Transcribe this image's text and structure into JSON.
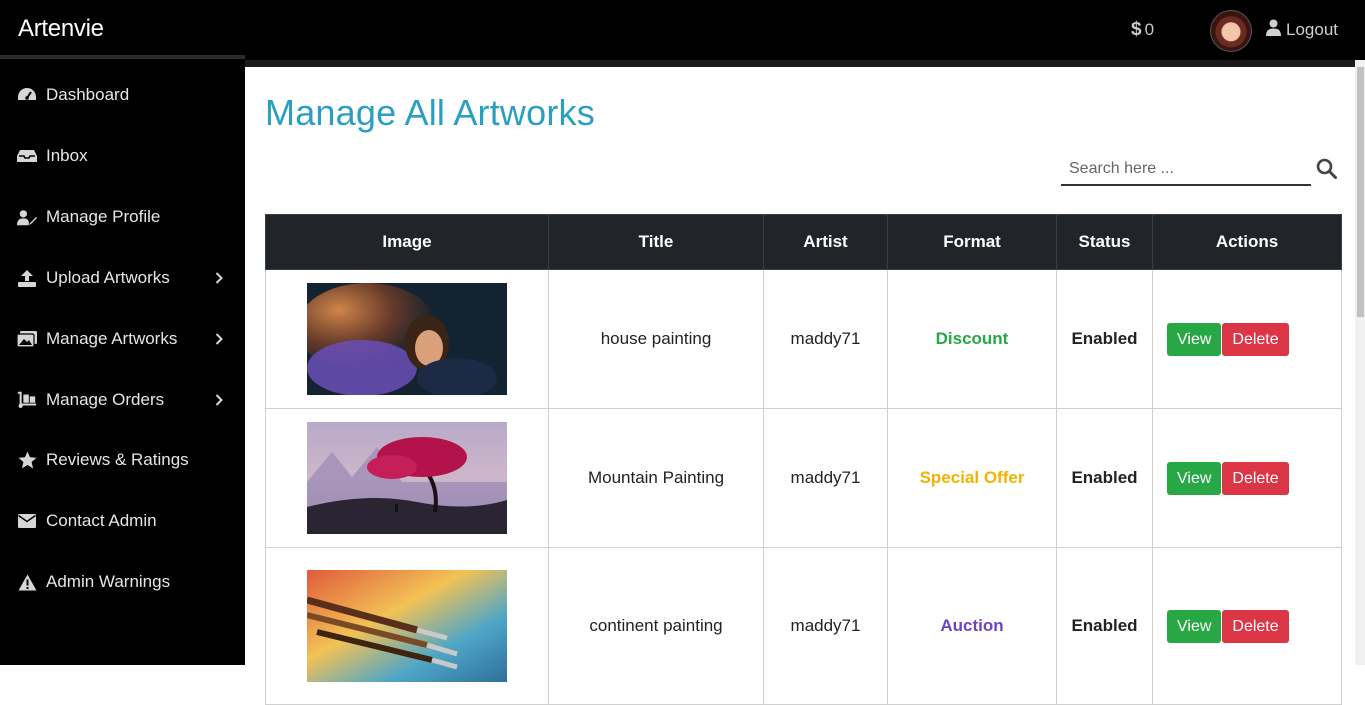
{
  "app": {
    "brand": "Artenvie"
  },
  "header": {
    "balance_symbol": "$",
    "balance_value": "0",
    "logout_label": "Logout"
  },
  "sidebar": {
    "items": [
      {
        "label": "Dashboard",
        "icon": "dashboard-icon",
        "has_submenu": false
      },
      {
        "label": "Inbox",
        "icon": "inbox-icon",
        "has_submenu": false
      },
      {
        "label": "Manage Profile",
        "icon": "user-edit-icon",
        "has_submenu": false
      },
      {
        "label": "Upload Artworks",
        "icon": "upload-icon",
        "has_submenu": true
      },
      {
        "label": "Manage Artworks",
        "icon": "images-icon",
        "has_submenu": true
      },
      {
        "label": "Manage Orders",
        "icon": "dolly-icon",
        "has_submenu": true
      },
      {
        "label": "Reviews & Ratings",
        "icon": "star-icon",
        "has_submenu": false
      },
      {
        "label": "Contact Admin",
        "icon": "envelope-icon",
        "has_submenu": false
      },
      {
        "label": "Admin Warnings",
        "icon": "warning-icon",
        "has_submenu": false
      }
    ]
  },
  "main": {
    "title": "Manage All Artworks",
    "search": {
      "placeholder": "Search here ...",
      "value": ""
    },
    "table": {
      "headers": [
        "Image",
        "Title",
        "Artist",
        "Format",
        "Status",
        "Actions"
      ],
      "rows": [
        {
          "title": "house painting",
          "artist": "maddy71",
          "format": "Discount",
          "status": "Enabled",
          "view_label": "View",
          "delete_label": "Delete"
        },
        {
          "title": "Mountain Painting",
          "artist": "maddy71",
          "format": "Special Offer",
          "status": "Enabled",
          "view_label": "View",
          "delete_label": "Delete"
        },
        {
          "title": "continent painting",
          "artist": "maddy71",
          "format": "Auction",
          "status": "Enabled",
          "view_label": "View",
          "delete_label": "Delete"
        }
      ]
    }
  },
  "colors": {
    "title": "#2a9fc1",
    "format_discount": "#28a745",
    "format_special_offer": "#f0b400",
    "format_auction": "#6f42c1",
    "btn_view": "#28a745",
    "btn_delete": "#dc3545"
  }
}
